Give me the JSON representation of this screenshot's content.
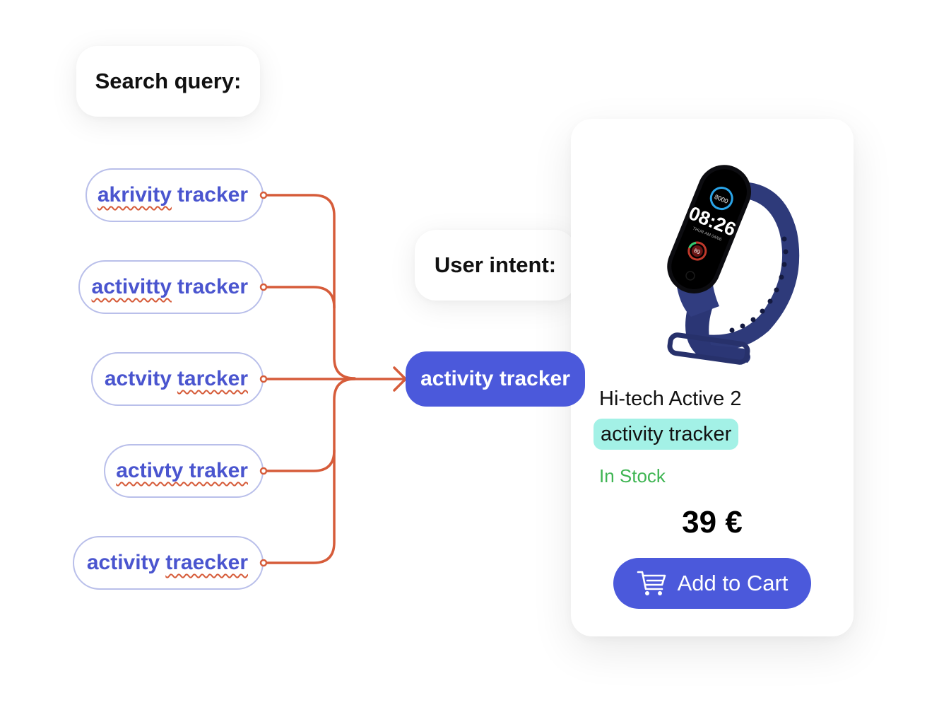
{
  "labels": {
    "search_query": "Search query:",
    "user_intent": "User intent:"
  },
  "queries": [
    {
      "typo": "akrivity",
      "rest": "tracker",
      "typo_position": "first"
    },
    {
      "typo": "activitty",
      "rest": "tracker",
      "typo_position": "first"
    },
    {
      "typo": "tarcker",
      "rest": "actvity",
      "typo_position": "second"
    },
    {
      "typo": "activty traker",
      "rest": "",
      "typo_position": "all"
    },
    {
      "typo": "traecker",
      "rest": "activity",
      "typo_position": "second"
    }
  ],
  "intent": {
    "text": "activity tracker"
  },
  "product": {
    "name": "Hi-tech Active 2",
    "category_tag": "activity tracker",
    "stock_status": "In Stock",
    "price": "39 €",
    "cart_button_label": "Add to Cart",
    "cart_icon": "shopping-cart-icon",
    "image_alt": "fitness band with watch face",
    "watch_face": {
      "time": "08:26",
      "steps": "8000",
      "date": "THUR AM 04/06",
      "heart_rate": "89"
    }
  },
  "colors": {
    "accent": "#4b59db",
    "query_text": "#4a55cf",
    "query_border": "#b9bfea",
    "connector": "#d65c3a",
    "highlight": "#a3f1e6",
    "in_stock": "#3fb553",
    "band": "#2e3a7a"
  }
}
